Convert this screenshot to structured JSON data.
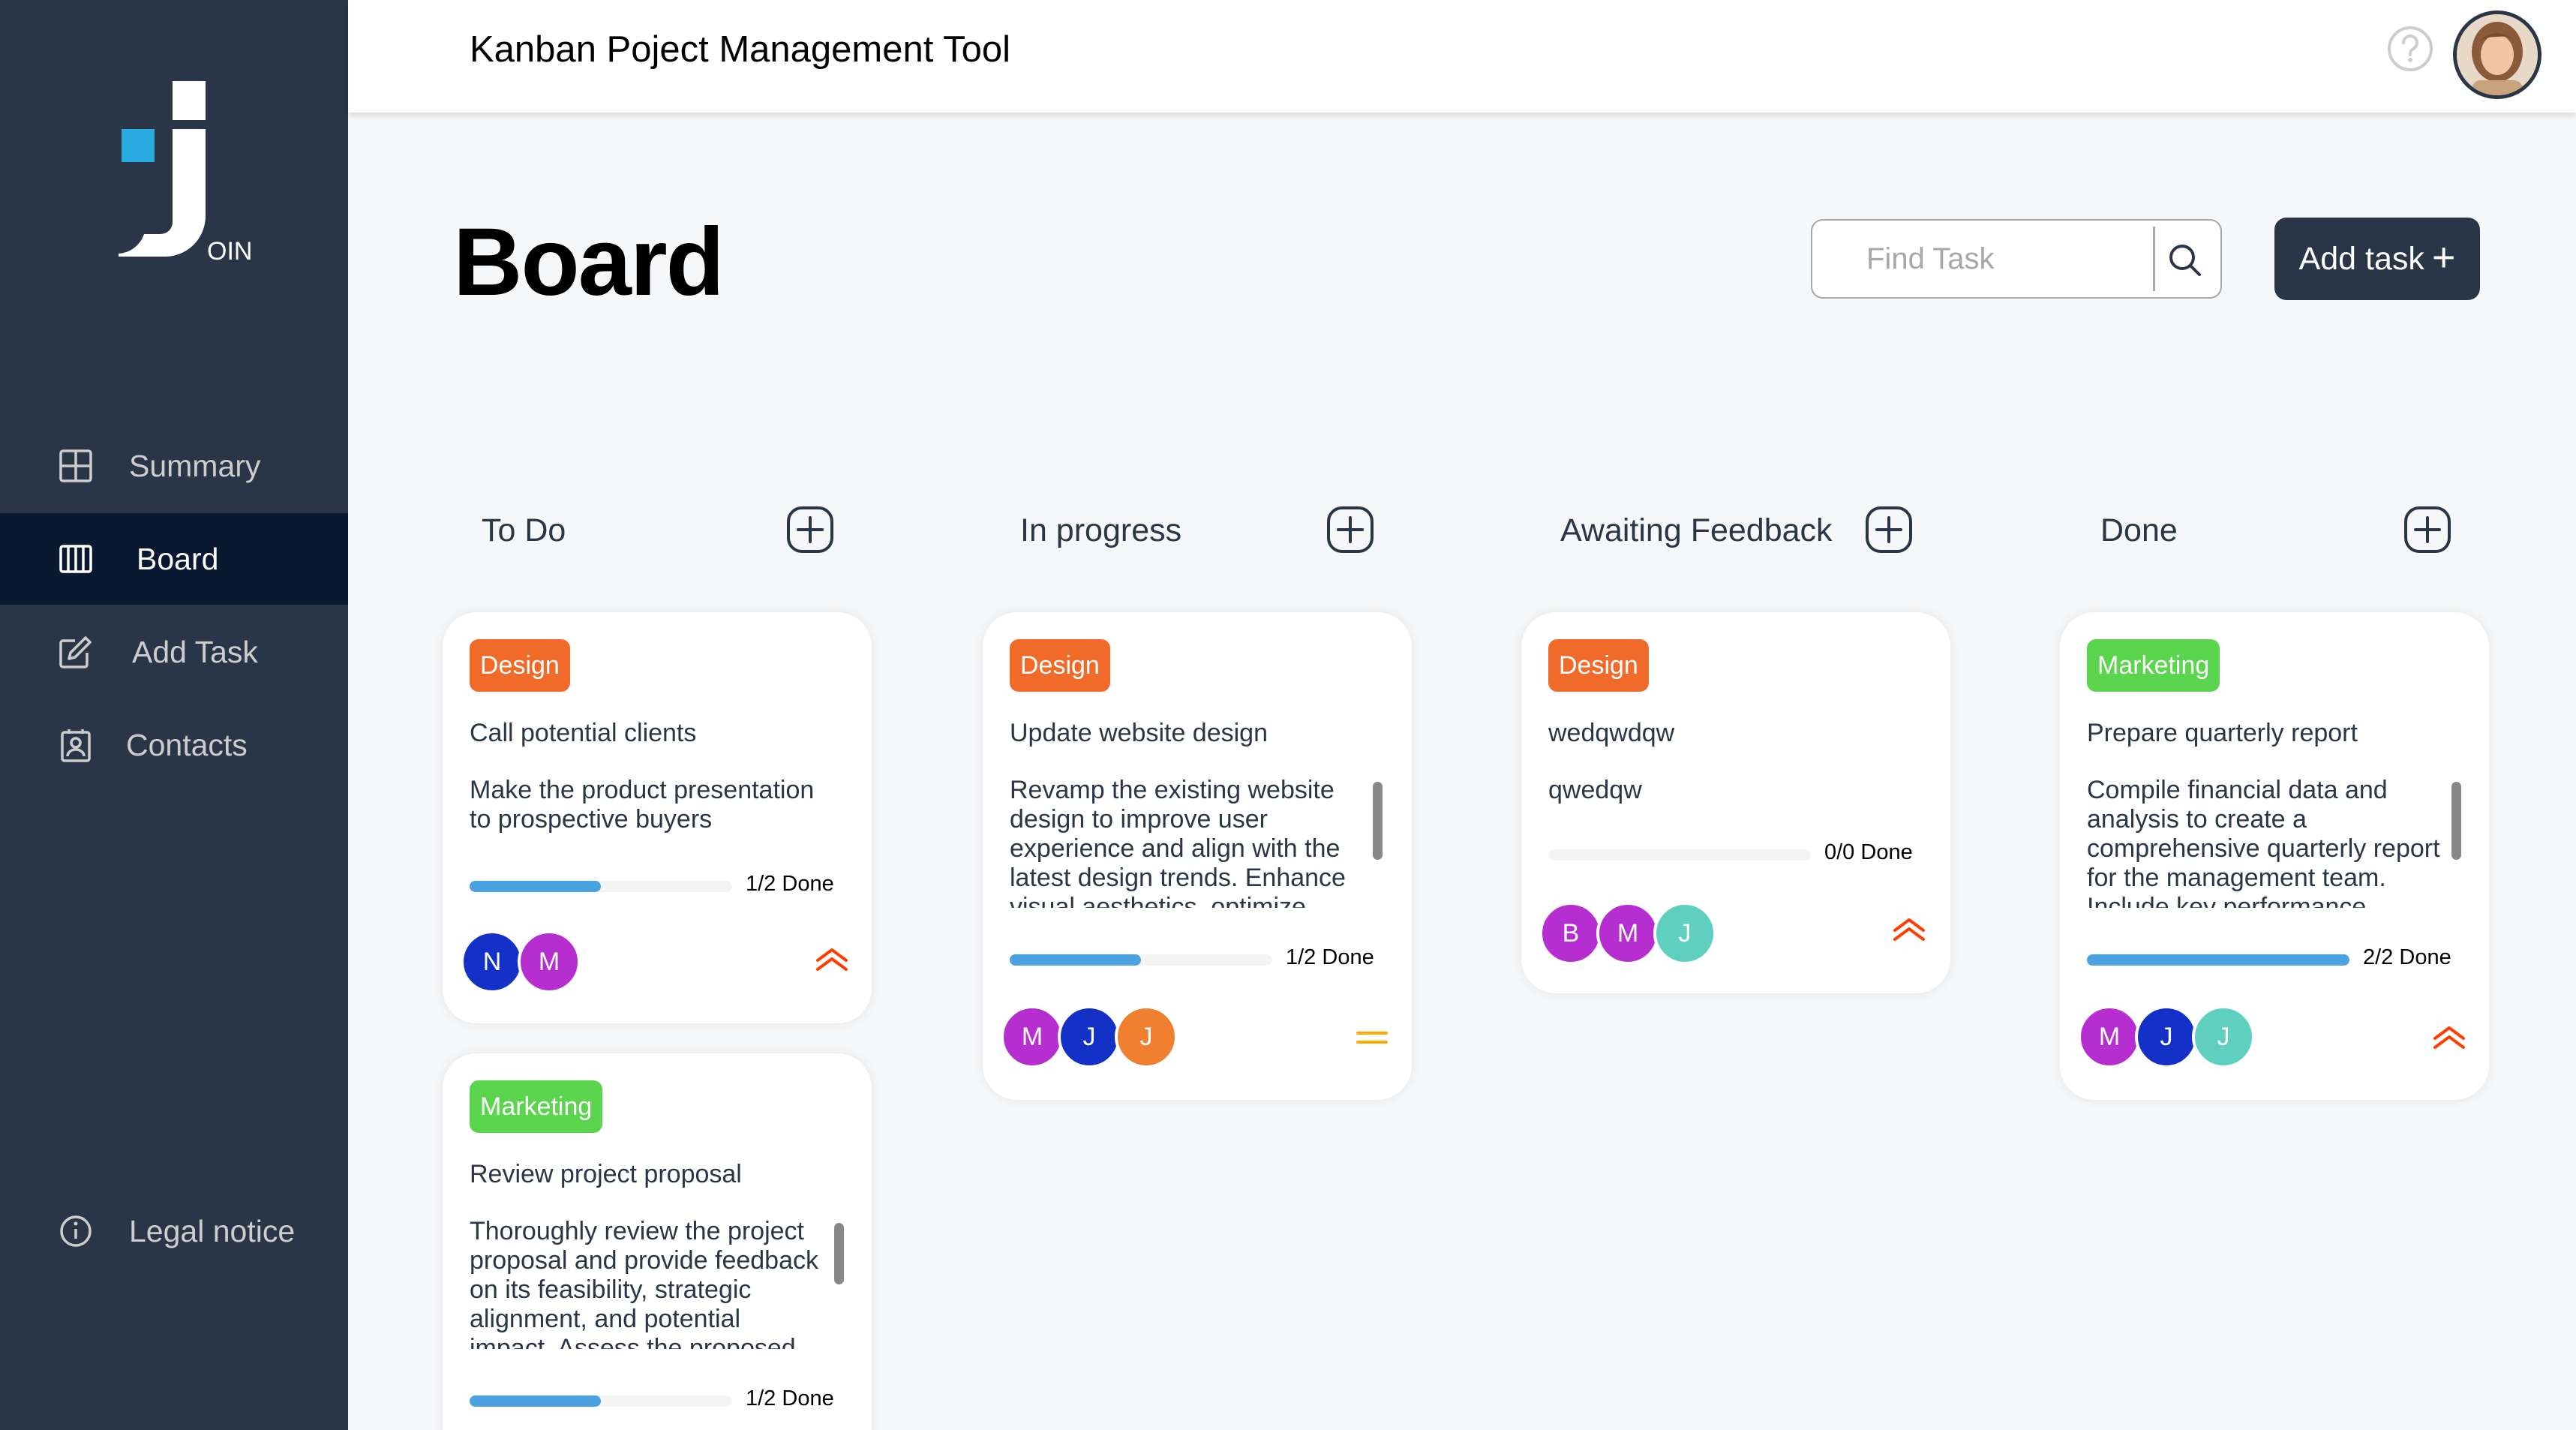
{
  "app": {
    "title": "Kanban Poject Management Tool",
    "logo_text": "OIN"
  },
  "colors": {
    "sidebar": "#2A3647",
    "sidebar_active": "#091931",
    "design_badge": "#FF7A00",
    "marketing_badge": "#1FD7C1",
    "progress": "#4AA3E0",
    "prio_urgent": "#FF3D00",
    "prio_medium": "#FFA800"
  },
  "sidebar": {
    "items": [
      {
        "label": "Summary",
        "icon": "summary-icon"
      },
      {
        "label": "Board",
        "icon": "board-icon"
      },
      {
        "label": "Add Task",
        "icon": "add-task-icon"
      },
      {
        "label": "Contacts",
        "icon": "contacts-icon"
      }
    ],
    "legal": {
      "label": "Legal notice",
      "icon": "info-icon"
    }
  },
  "board": {
    "title": "Board",
    "search_placeholder": "Find Task",
    "add_task_label": "Add task",
    "add_task_plus": "+"
  },
  "columns": [
    {
      "title": "To Do"
    },
    {
      "title": "In progress"
    },
    {
      "title": "Awaiting Feedback"
    },
    {
      "title": "Done"
    }
  ],
  "cards": [
    {
      "category": "Design",
      "title": "Call potential clients",
      "description": "Make the product presentation to prospective buyers",
      "progress": 0.5,
      "progress_label": "1/2 Done",
      "assignees": [
        "N",
        "M"
      ],
      "priority": "urgent"
    },
    {
      "category": "Marketing",
      "title": "Review project proposal",
      "description": "Thoroughly review the project proposal and provide feedback on its feasibility, strategic alignment, and potential impact. Assess the proposed",
      "progress": 0.5,
      "progress_label": "1/2 Done",
      "assignees": [],
      "priority": ""
    },
    {
      "category": "Design",
      "title": "Update website design",
      "description": "Revamp the existing website design to improve user experience and align with the latest design trends. Enhance visual aesthetics, optimize page",
      "progress": 0.5,
      "progress_label": "1/2 Done",
      "assignees": [
        "M",
        "J",
        "J"
      ],
      "priority": "medium"
    },
    {
      "category": "Design",
      "title": "wedqwdqw",
      "description": "qwedqw",
      "progress": 0,
      "progress_label": "0/0 Done",
      "assignees": [
        "B",
        "M",
        "J"
      ],
      "priority": "urgent"
    },
    {
      "category": "Marketing",
      "title": "Prepare quarterly report",
      "description": "Compile financial data and analysis to create a comprehensive quarterly report for the management team. Include key performance",
      "progress": 1,
      "progress_label": "2/2 Done",
      "assignees": [
        "M",
        "J",
        "J"
      ],
      "priority": "urgent"
    }
  ]
}
